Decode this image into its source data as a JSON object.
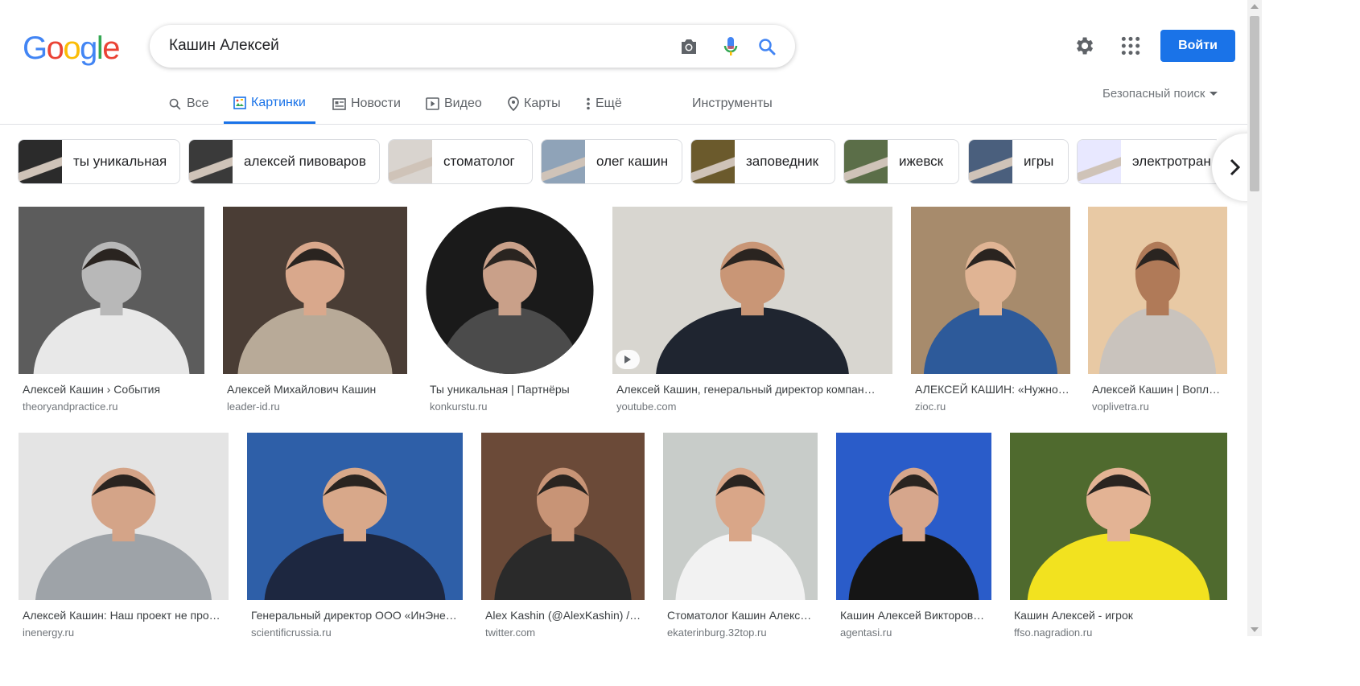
{
  "logo": [
    "G",
    "o",
    "o",
    "g",
    "l",
    "e"
  ],
  "logo_colors": [
    "#4285f4",
    "#ea4335",
    "#fbbc05",
    "#4285f4",
    "#34a853",
    "#ea4335"
  ],
  "search": {
    "query": "Кашин Алексей"
  },
  "header": {
    "signin_label": "Войти"
  },
  "tabs": [
    {
      "label": "Все",
      "icon": "search-icon"
    },
    {
      "label": "Картинки",
      "icon": "image-icon",
      "active": true
    },
    {
      "label": "Новости",
      "icon": "news-icon"
    },
    {
      "label": "Видео",
      "icon": "video-icon"
    },
    {
      "label": "Карты",
      "icon": "map-pin-icon"
    },
    {
      "label": "Ещё",
      "icon": "more-vert-icon"
    }
  ],
  "tools_label": "Инструменты",
  "safe_search_label": "Безопасный поиск",
  "chips": [
    {
      "label": "ты уникальная",
      "bg": "#2b2b2b"
    },
    {
      "label": "алексей пивоваров",
      "bg": "#3a3a3a"
    },
    {
      "label": "стоматолог",
      "bg": "#d9d4cf"
    },
    {
      "label": "олег кашин",
      "bg": "#8fa3b8"
    },
    {
      "label": "заповедник",
      "bg": "#6b5a2c"
    },
    {
      "label": "ижевск",
      "bg": "#5b6e48"
    },
    {
      "label": "игры",
      "bg": "#4a5f7d"
    },
    {
      "label": "электротран",
      "bg": "#e8e8ff"
    }
  ],
  "results_row1": [
    {
      "title": "Алексей Кашин › События",
      "source": "theoryandpractice.ru",
      "bg": "#5c5c5c",
      "face": "#b8b8b8",
      "suit": "#e8e8e8"
    },
    {
      "title": "Алексей Михайлович Кашин",
      "source": "leader-id.ru",
      "bg": "#4a3d35",
      "face": "#d9a88c",
      "suit": "#b8aa98"
    },
    {
      "title": "Ты уникальная | Партнёры",
      "source": "konkurstu.ru",
      "bg": "#1a1a1a",
      "face": "#c9a089",
      "suit": "#4b4b4b",
      "round": true
    },
    {
      "title": "Алексей Кашин, генеральный директор компан…",
      "source": "youtube.com",
      "bg": "#d8d6d0",
      "face": "#c99676",
      "suit": "#1f2530",
      "video": true
    },
    {
      "title": "АЛЕКСЕЙ КАШИН: «Нужно…",
      "source": "zioc.ru",
      "bg": "#a78b6c",
      "face": "#e0b494",
      "suit": "#2d5a9a"
    },
    {
      "title": "Алексей Кашин | Вопл…",
      "source": "voplivetra.ru",
      "bg": "#e8c9a4",
      "face": "#b07a58",
      "suit": "#c9c3bd"
    }
  ],
  "results_row2": [
    {
      "title": "Алексей Кашин: Наш проект не про…",
      "source": "inenergy.ru",
      "bg": "#e4e4e4",
      "face": "#d4a488",
      "suit": "#9ea3a8"
    },
    {
      "title": "Генеральный директор ООО «ИнЭне…",
      "source": "scientificrussia.ru",
      "bg": "#2e5fa8",
      "face": "#d8a88a",
      "suit": "#1d2740"
    },
    {
      "title": "Alex Kashin (@AlexKashin) /…",
      "source": "twitter.com",
      "bg": "#6b4a38",
      "face": "#c89476",
      "suit": "#2a2a2a"
    },
    {
      "title": "Стоматолог Кашин Алекс…",
      "source": "ekaterinburg.32top.ru",
      "bg": "#c8ccc9",
      "face": "#d9a688",
      "suit": "#f2f2f2"
    },
    {
      "title": "Кашин Алексей Викторов…",
      "source": "agentasi.ru",
      "bg": "#2a5cc9",
      "face": "#d6a68c",
      "suit": "#151515"
    },
    {
      "title": "Кашин Алексей - игрок",
      "source": "ffso.nagradion.ru",
      "bg": "#4f6a2e",
      "face": "#e3b394",
      "suit": "#f2e21f"
    }
  ]
}
